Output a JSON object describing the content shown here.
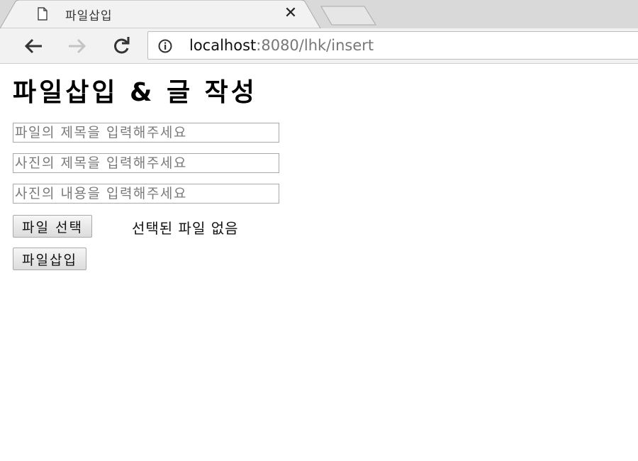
{
  "browser": {
    "tab_title": "파일삽입",
    "url_host": "localhost",
    "url_rest": ":8080/lhk/insert"
  },
  "page": {
    "heading": "파일삽입 & 글 작성",
    "fields": {
      "file_title_placeholder": "파일의 제목을 입력해주세요",
      "photo_title_placeholder": "사진의 제목을 입력해주세요",
      "photo_content_placeholder": "사진의 내용을 입력해주세요"
    },
    "file_picker": {
      "button_label": "파일 선택",
      "status_text": "선택된 파일 없음"
    },
    "submit_label": "파일삽입"
  }
}
